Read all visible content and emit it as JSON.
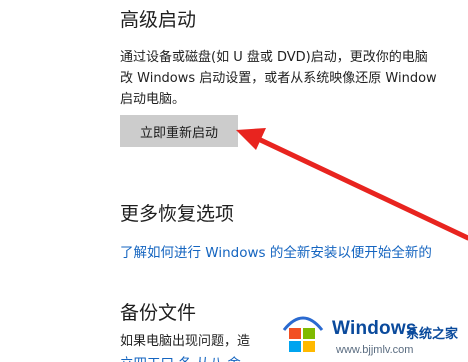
{
  "advanced_startup": {
    "title": "高级启动",
    "description_lines": [
      "通过设备或磁盘(如 U 盘或 DVD)启动，更改你的电脑",
      "改 Windows 启动设置，或者从系统映像还原 Window",
      "启动电脑。"
    ],
    "restart_button": "立即重新启动"
  },
  "more_recovery": {
    "title": "更多恢复选项",
    "link": "了解如何进行 Windows 的全新安装以便开始全新的"
  },
  "backup": {
    "title": "备份文件",
    "description": "如果电脑出现问题，造",
    "link_fragment": "立四工口 冬 从八 舍"
  },
  "watermark": {
    "brand": "Windows",
    "subtitle": "系统之家",
    "url": "www.bjjmlv.com"
  },
  "colors": {
    "arrow": "#e8241f",
    "link": "#1565c0",
    "button_bg": "#cccccc"
  }
}
